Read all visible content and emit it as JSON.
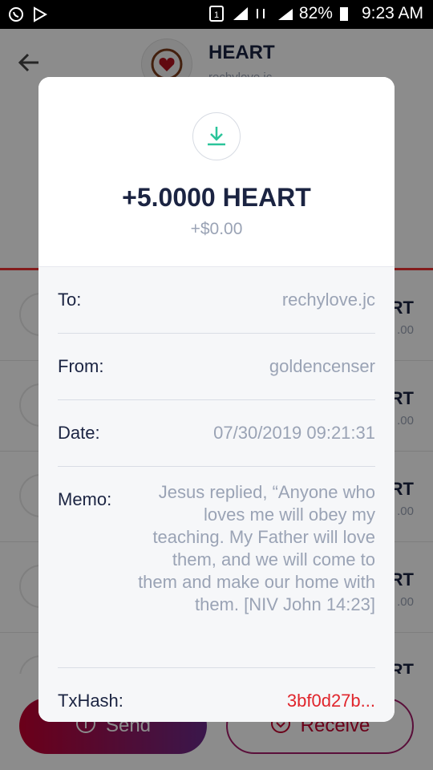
{
  "status_bar": {
    "battery": "82%",
    "time": "9:23 AM"
  },
  "token": {
    "symbol": "HEART",
    "account": "rechylove.jc"
  },
  "list": {
    "rows": [
      {
        "label": "RT",
        "sub": ".00"
      },
      {
        "label": "RT",
        "sub": ".00"
      },
      {
        "label": "RT",
        "sub": ".00"
      },
      {
        "label": "RT",
        "sub": ".00"
      },
      {
        "label": "RT",
        "sub": ""
      }
    ]
  },
  "buttons": {
    "send": "Send",
    "receive": "Receive"
  },
  "modal": {
    "amount": "+5.0000 HEART",
    "fiat": "+$0.00",
    "to_label": "To:",
    "to_value": "rechylove.jc",
    "from_label": "From:",
    "from_value": "goldencenser",
    "date_label": "Date:",
    "date_value": "07/30/2019 09:21:31",
    "memo_label": "Memo:",
    "memo_value": "Jesus replied, “Anyone who loves me will obey my teaching. My Father will love them, and we will come to them and make our home with them. [NIV John 14:23]",
    "txhash_label": "TxHash:",
    "txhash_value": "3bf0d27b..."
  },
  "colors": {
    "accent_green": "#2bc49a",
    "hash_red": "#e0252c",
    "text_dark": "#1b2442",
    "text_muted": "#9aa3b5"
  }
}
